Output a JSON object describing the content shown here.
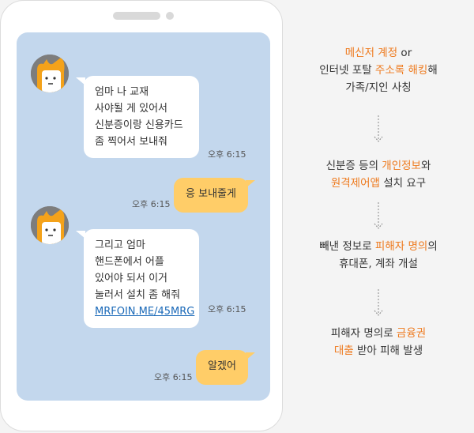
{
  "chat": {
    "messages": [
      {
        "from": "them",
        "lines": [
          "엄마 나 교재",
          "사야될 게 있어서",
          "신분증이랑 신용카드",
          "좀 찍어서 보내줘"
        ],
        "time": "오후 6:15"
      },
      {
        "from": "me",
        "text": "응 보내줄게",
        "time": "오후 6:15"
      },
      {
        "from": "them",
        "lines": [
          "그리고 엄마",
          "핸드폰에서 어플",
          "있어야 되서 이거",
          "눌러서 설치 좀 해줘"
        ],
        "link": "MRFOIN.ME/45MRG",
        "time": "오후 6:15"
      },
      {
        "from": "me",
        "text": "알겠어",
        "time": "오후 6:15"
      }
    ]
  },
  "flow": {
    "step1": {
      "a_hl": "메신저 계정",
      "a": " or",
      "b": "인터넷 포탈 ",
      "b_hl": "주소록 해킹",
      "b2": "해",
      "c": "가족/지인 사칭"
    },
    "step2": {
      "a": "신분증 등의 ",
      "a_hl": "개인정보",
      "a2": "와",
      "b_hl": "원격제어앱",
      "b": " 설치 요구"
    },
    "step3": {
      "a": "빼낸 정보로 ",
      "a_hl": "피해자 명의",
      "a2": "의",
      "b": "휴대폰, 계좌 개설"
    },
    "step4": {
      "a": "피해자 명의로 ",
      "a_hl": "금융권",
      "b_hl": "대출",
      "b": " 받아 피해 발생"
    }
  },
  "colors": {
    "accent": "#ee7a1e",
    "chat_bg": "#c3d7ed",
    "my_bubble": "#ffcd68",
    "link": "#1a69b8"
  }
}
